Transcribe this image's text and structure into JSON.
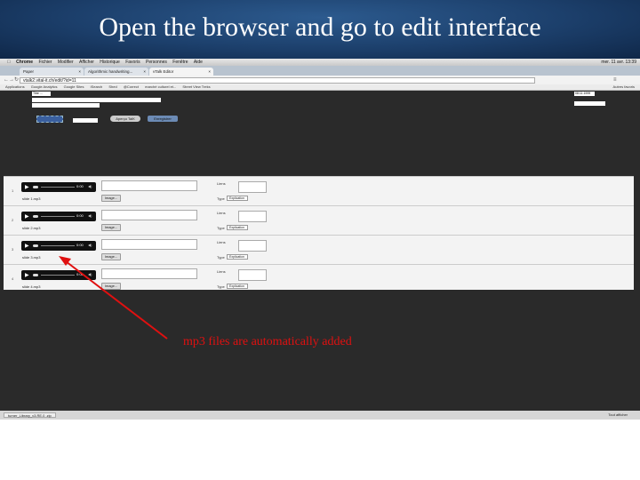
{
  "slide": {
    "title": "Open the browser and go to edit interface",
    "caption": "mp3 files are automatically added",
    "accent_color": "#e01010",
    "header_color": "#1c3f6b"
  },
  "menubar": {
    "items": [
      "Chrome",
      "Fichier",
      "Modifier",
      "Afficher",
      "Historique",
      "Favoris",
      "Personnes",
      "Fenêtre",
      "Aide"
    ],
    "clock": "mer. 11 avr. 13:39"
  },
  "tabs": [
    {
      "label": "Paper"
    },
    {
      "label": "Algorithmic handwriting..."
    },
    {
      "label": "vTalk Editor"
    }
  ],
  "address": {
    "url": "vtalk2.vital-it.ch/edit/?id=11"
  },
  "bookmarks": {
    "items": [
      "Applications",
      "Google Analytics",
      "Google Sites",
      "iSearch",
      "Shed",
      "@Correct",
      "marché culturel et...",
      "Street View Treks"
    ],
    "other": "Autres favoris"
  },
  "editor": {
    "title_value": "Titre ...",
    "date_value": "08.11.1999",
    "preview_label": "Aperçu TalK",
    "save_label": "Enregistrer"
  },
  "slides": [
    {
      "num": "1",
      "file": "slide 1.mp3",
      "time": "0:00"
    },
    {
      "num": "2",
      "file": "slide 2.mp3",
      "time": "0:00"
    },
    {
      "num": "3",
      "file": "slide 3.mp3",
      "time": "0:00"
    },
    {
      "num": "4",
      "file": "slide 4.mp3",
      "time": "0:00"
    }
  ],
  "row_labels": {
    "image_button": "Image...",
    "lien": "Liens",
    "type": "Type",
    "type_value": "Explication"
  },
  "statusbar": {
    "download": "turner_Library_v3.RE.0 .zip",
    "show_all": "Tout afficher"
  }
}
